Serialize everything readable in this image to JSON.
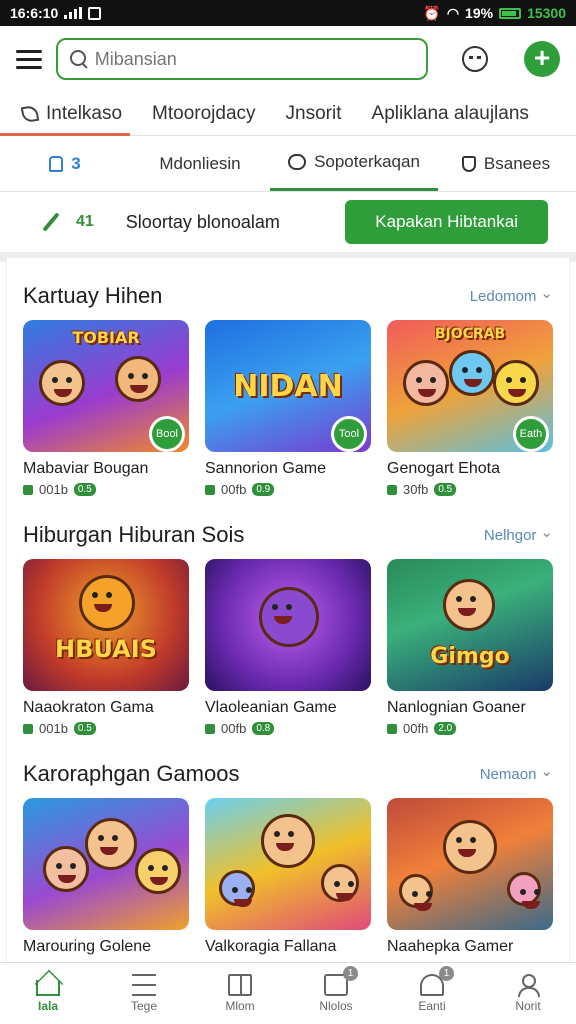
{
  "status_bar": {
    "time": "16:6:10",
    "battery_pct": "19%",
    "clock_right": "15300"
  },
  "header": {
    "search_placeholder": "Mibansian"
  },
  "top_tabs": [
    {
      "label": "Intelkaso"
    },
    {
      "label": "Mtoorojdacy"
    },
    {
      "label": "Jnsorit"
    },
    {
      "label": "Apliklana alaujlans"
    }
  ],
  "sub_tabs": [
    {
      "label": "3"
    },
    {
      "label": "Mdonliesin"
    },
    {
      "label": "Sopoterkaqan"
    },
    {
      "label": "Bsanees"
    }
  ],
  "promo": {
    "count": "41",
    "text": "Sloortay blonoalam",
    "button": "Kapakan Hibtankai"
  },
  "sections": [
    {
      "title": "Kartuay Hihen",
      "more": "Ledomom",
      "cards": [
        {
          "name": "Mabaviar Bougan",
          "art": "TOBIAR",
          "badge": "Bool",
          "downloads": "001b",
          "pill": "0.5"
        },
        {
          "name": "Sannorion Game",
          "art": "NIDAN",
          "badge": "Tool",
          "downloads": "00fb",
          "pill": "0.9"
        },
        {
          "name": "Genogart Ehota",
          "art": "BJOCRAB",
          "badge": "Eath",
          "downloads": "30fb",
          "pill": "0.5"
        }
      ]
    },
    {
      "title": "Hiburgan Hiburan Sois",
      "more": "Nelhgor",
      "cards": [
        {
          "name": "Naaokraton Gama",
          "art": "HBUAIS",
          "downloads": "001b",
          "pill": "0.5"
        },
        {
          "name": "Vlaoleanian Game",
          "art": "",
          "downloads": "00fb",
          "pill": "0.8"
        },
        {
          "name": "Nanlognian Goaner",
          "art": "Gimgo",
          "downloads": "00fh",
          "pill": "2.0"
        }
      ]
    },
    {
      "title": "Karoraphgan Gamoos",
      "more": "Nemaon",
      "cards": [
        {
          "name": "Marouring Golene",
          "art": ""
        },
        {
          "name": "Valkoragia Fallana",
          "art": ""
        },
        {
          "name": "Naahepka Gamer",
          "art": ""
        }
      ]
    }
  ],
  "bottom_nav": [
    {
      "label": "Iala",
      "icon": "home-icon",
      "badge": ""
    },
    {
      "label": "Tege",
      "icon": "list-icon",
      "badge": ""
    },
    {
      "label": "Mlom",
      "icon": "book-icon",
      "badge": ""
    },
    {
      "label": "Nlolos",
      "icon": "box-icon",
      "badge": "1"
    },
    {
      "label": "Eanti",
      "icon": "bell-icon",
      "badge": "1"
    },
    {
      "label": "Norit",
      "icon": "user-icon",
      "badge": ""
    }
  ],
  "colors": {
    "accent_green": "#2f9e3a",
    "tab_underline": "#e2684a",
    "link_blue": "#5a88b8"
  }
}
